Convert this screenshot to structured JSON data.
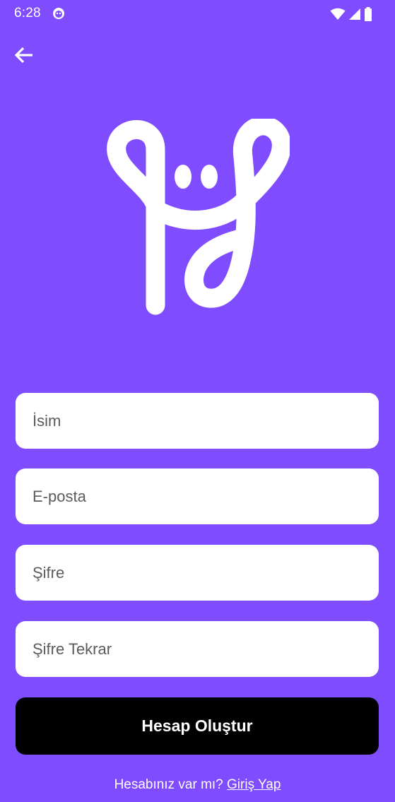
{
  "status_bar": {
    "time": "6:28",
    "icons": [
      "app-notification-icon",
      "wifi-icon",
      "signal-icon",
      "battery-icon"
    ]
  },
  "navigation": {
    "back_icon": "arrow-left-icon"
  },
  "logo": {
    "icon": "app-logo-icon"
  },
  "form": {
    "name_placeholder": "İsim",
    "email_placeholder": "E-posta",
    "password_placeholder": "Şifre",
    "password_repeat_placeholder": "Şifre Tekrar",
    "submit_label": "Hesap Oluştur"
  },
  "footer": {
    "question": "Hesabınız var mı?",
    "login_link": "Giriş Yap"
  },
  "colors": {
    "background": "#7f4cff",
    "field_background": "#ffffff",
    "button_background": "#000000",
    "text_on_accent": "#ffffff"
  }
}
